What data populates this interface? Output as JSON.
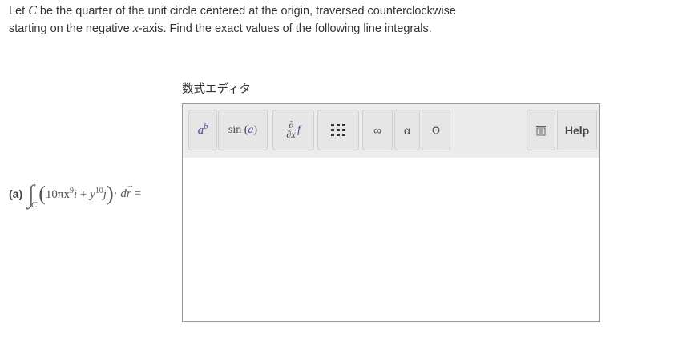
{
  "question": {
    "line1_pre": "Let ",
    "line1_var": "C",
    "line1_post": " be the quarter of the unit circle centered at the origin, traversed counterclockwise",
    "line2_pre": "starting on the negative ",
    "line2_var": "x",
    "line2_post": "-axis. Find the exact values of the following line integrals."
  },
  "editor": {
    "title": "数式エディタ",
    "toolbar": {
      "power_base": "a",
      "power_exp": "b",
      "sin_label": "sin",
      "sin_arg": "a",
      "deriv_num": "∂",
      "deriv_den": "∂x",
      "deriv_f": "f",
      "infinity": "∞",
      "alpha": "α",
      "omega": "Ω",
      "help": "Help"
    }
  },
  "problem": {
    "label": "(a)",
    "integral": "∫",
    "subscript": "C",
    "coef": "10πx",
    "exp1": "9",
    "i": "i",
    "plus": " + ",
    "y": "y",
    "exp2": "10",
    "j": "j",
    "dot": " · ",
    "dr_d": "d",
    "dr_r": "r",
    "equals": " ="
  }
}
